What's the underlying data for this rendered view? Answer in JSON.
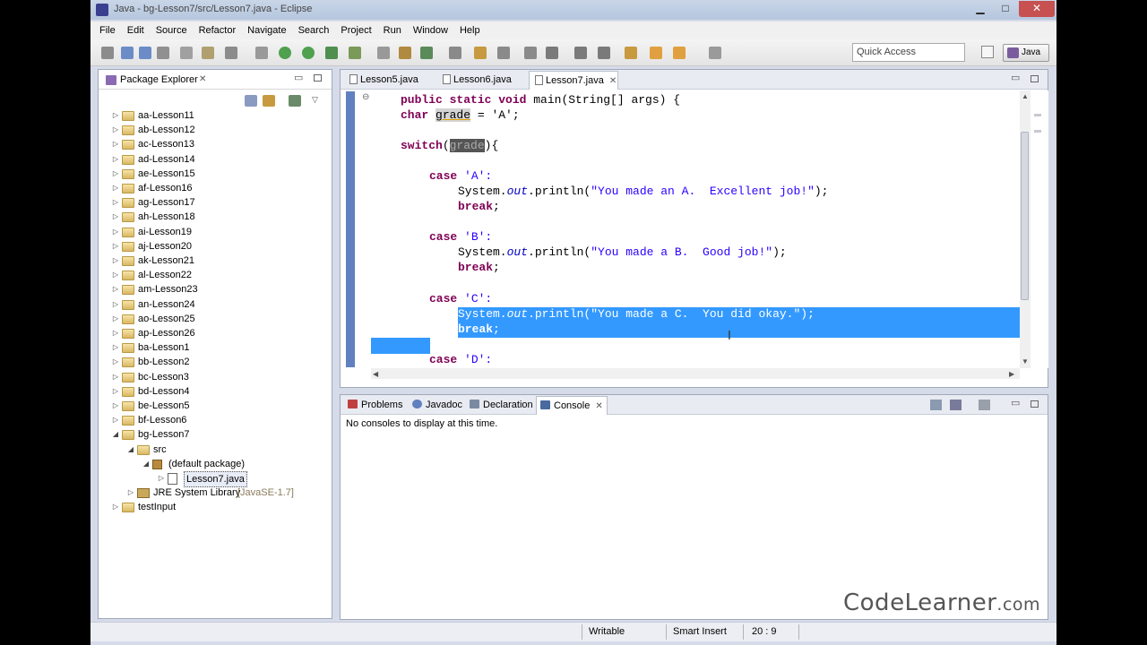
{
  "window": {
    "title": "Java - bg-Lesson7/src/Lesson7.java - Eclipse",
    "min_label": "▁",
    "max_label": "□",
    "close_label": "✕"
  },
  "menu": [
    "File",
    "Edit",
    "Source",
    "Refactor",
    "Navigate",
    "Search",
    "Project",
    "Run",
    "Window",
    "Help"
  ],
  "toolbar": {
    "quick_access_placeholder": "Quick Access",
    "perspective_label": "Java"
  },
  "package_explorer": {
    "title": "Package Explorer",
    "close": "✕",
    "minimize": "▭",
    "items": [
      {
        "label": "aa-Lesson11",
        "level": 0,
        "expanded": false
      },
      {
        "label": "ab-Lesson12",
        "level": 0,
        "expanded": false
      },
      {
        "label": "ac-Lesson13",
        "level": 0,
        "expanded": false
      },
      {
        "label": "ad-Lesson14",
        "level": 0,
        "expanded": false
      },
      {
        "label": "ae-Lesson15",
        "level": 0,
        "expanded": false
      },
      {
        "label": "af-Lesson16",
        "level": 0,
        "expanded": false
      },
      {
        "label": "ag-Lesson17",
        "level": 0,
        "expanded": false
      },
      {
        "label": "ah-Lesson18",
        "level": 0,
        "expanded": false
      },
      {
        "label": "ai-Lesson19",
        "level": 0,
        "expanded": false
      },
      {
        "label": "aj-Lesson20",
        "level": 0,
        "expanded": false
      },
      {
        "label": "ak-Lesson21",
        "level": 0,
        "expanded": false
      },
      {
        "label": "al-Lesson22",
        "level": 0,
        "expanded": false
      },
      {
        "label": "am-Lesson23",
        "level": 0,
        "expanded": false
      },
      {
        "label": "an-Lesson24",
        "level": 0,
        "expanded": false
      },
      {
        "label": "ao-Lesson25",
        "level": 0,
        "expanded": false
      },
      {
        "label": "ap-Lesson26",
        "level": 0,
        "expanded": false
      },
      {
        "label": "ba-Lesson1",
        "level": 0,
        "expanded": false
      },
      {
        "label": "bb-Lesson2",
        "level": 0,
        "expanded": false
      },
      {
        "label": "bc-Lesson3",
        "level": 0,
        "expanded": false
      },
      {
        "label": "bd-Lesson4",
        "level": 0,
        "expanded": false
      },
      {
        "label": "be-Lesson5",
        "level": 0,
        "expanded": false
      },
      {
        "label": "bf-Lesson6",
        "level": 0,
        "expanded": false
      },
      {
        "label": "bg-Lesson7",
        "level": 0,
        "expanded": true
      },
      {
        "label": "src",
        "level": 1,
        "expanded": true
      },
      {
        "label": "(default package)",
        "level": 2,
        "expanded": true
      },
      {
        "label": "Lesson7.java",
        "level": 3,
        "expanded": false,
        "selected": true
      },
      {
        "label": "JRE System Library",
        "suffix": "[JavaSE-1.7]",
        "level": 1,
        "expanded": false
      },
      {
        "label": "testInput",
        "level": 0,
        "expanded": false
      }
    ]
  },
  "editor": {
    "tabs": [
      {
        "label": "Lesson5.java",
        "active": false
      },
      {
        "label": "Lesson6.java",
        "active": false
      },
      {
        "label": "Lesson7.java",
        "active": true
      }
    ],
    "tab_close": "✕",
    "code": {
      "l1_kw": "public static void",
      "l1_rest": " main(String[] args) {",
      "l2_kw": "char",
      "l2_var": "grade",
      "l2_rest": " = 'A';",
      "l3_kw": "switch",
      "l3_open": "(",
      "l3_var": "grade",
      "l3_close": "){",
      "case_kw": "case",
      "caseA": " 'A':",
      "sysout": "System.",
      "out": "out",
      "println_open": ".println(",
      "msgA": "\"You made an A.  Excellent job!\"",
      "close_paren": ");",
      "break_kw": "break",
      "semicolon": ";",
      "caseB": " 'B':",
      "msgB": "\"You made a B.  Good job!\"",
      "caseC": " 'C':",
      "msgC": "\"You made a C.  You did okay.\"",
      "caseD": " 'D':"
    }
  },
  "console": {
    "tabs": [
      {
        "label": "Problems",
        "active": false
      },
      {
        "label": "Javadoc",
        "active": false
      },
      {
        "label": "Declaration",
        "active": false
      },
      {
        "label": "Console",
        "active": true
      }
    ],
    "message": "No consoles to display at this time."
  },
  "status": {
    "writable": "Writable",
    "insert_mode": "Smart Insert",
    "position": "20 : 9"
  },
  "brand": {
    "name": "CodeLearner",
    "suffix": ".com"
  },
  "colors": {
    "keyword": "#7f0055",
    "string": "#2a00ff",
    "field": "#0000c0",
    "selection": "#3399ff"
  }
}
